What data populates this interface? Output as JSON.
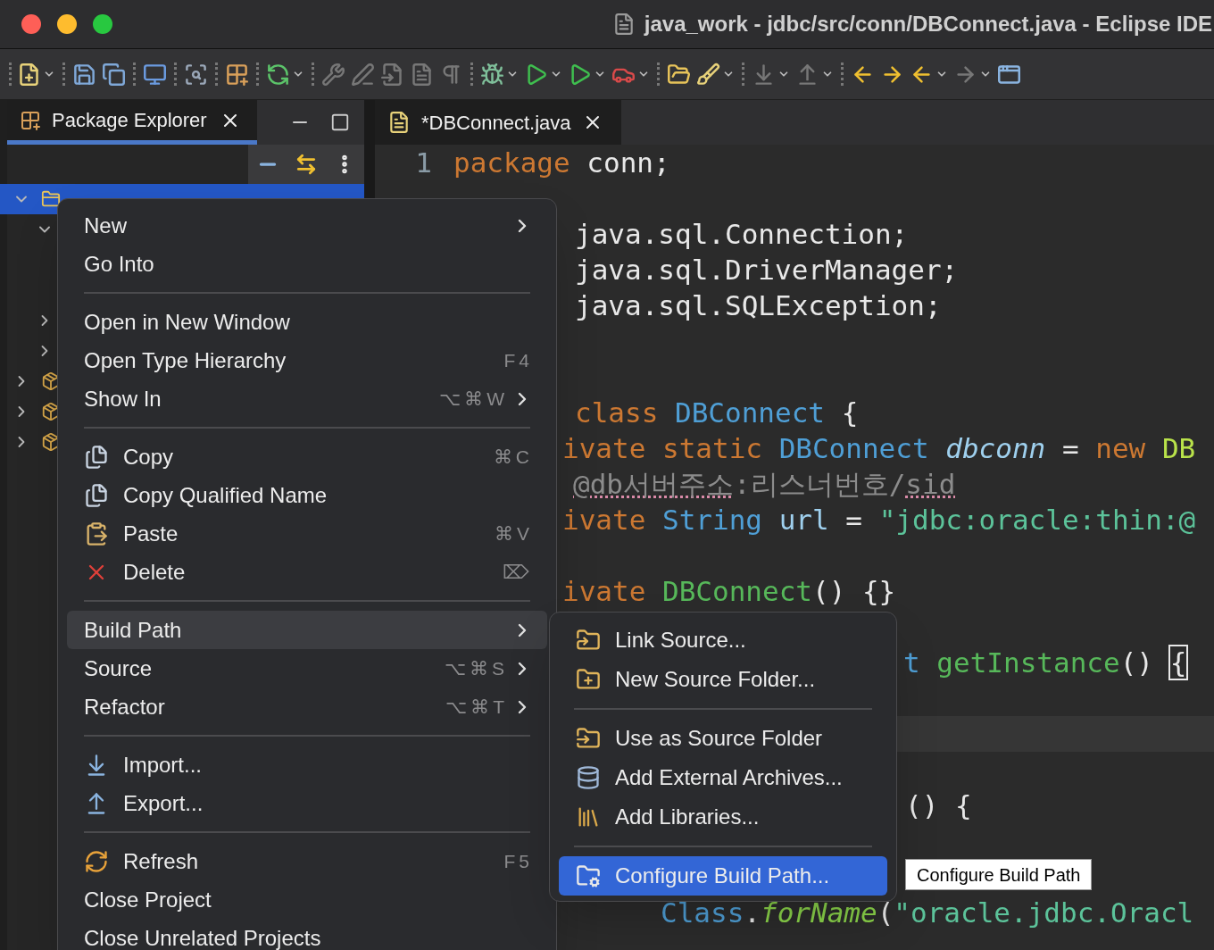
{
  "window": {
    "title": "java_work - jdbc/src/conn/DBConnect.java - Eclipse IDE"
  },
  "package_explorer": {
    "tab": {
      "label": "Package Explorer",
      "selected": true
    },
    "tree": [
      {
        "kind": "node",
        "expanded": true,
        "selected": true,
        "children": [
          {
            "kind": "node",
            "expanded": true,
            "selected": false,
            "children": [
              {
                "kind": "covered"
              },
              {
                "kind": "covered"
              }
            ]
          },
          {
            "kind": "node",
            "expanded": false,
            "selected": false
          },
          {
            "kind": "node",
            "expanded": false,
            "selected": false
          }
        ]
      },
      {
        "kind": "node",
        "expanded": false,
        "selected": false
      },
      {
        "kind": "node",
        "expanded": false,
        "selected": false
      },
      {
        "kind": "node",
        "expanded": false,
        "selected": false
      }
    ]
  },
  "editor": {
    "tab": {
      "label": "*DBConnect.java",
      "selected": true
    },
    "lines": [
      {
        "kind": "code",
        "number": "1",
        "tokens": [
          {
            "kind": "keyword",
            "text": "package"
          },
          {
            "kind": "plain",
            "text": " conn;"
          }
        ]
      },
      {
        "kind": "code",
        "tokens": [
          {
            "kind": "plain",
            "text": "java.sql.Connection;"
          }
        ]
      },
      {
        "kind": "code",
        "tokens": [
          {
            "kind": "plain",
            "text": "java.sql.DriverManager;"
          }
        ]
      },
      {
        "kind": "code",
        "tokens": [
          {
            "kind": "plain",
            "text": "java.sql.SQLException;"
          }
        ]
      },
      {
        "kind": "code",
        "tokens": [
          {
            "kind": "keyword",
            "text": "class"
          },
          {
            "kind": "type",
            "text": " DBConnect"
          },
          {
            "kind": "plain",
            "text": " {"
          }
        ]
      },
      {
        "kind": "code",
        "tokens": [
          {
            "kind": "keyword",
            "text": "ivate static"
          },
          {
            "kind": "type",
            "text": " DBConnect"
          },
          {
            "kind": "static_field",
            "text": " dbconn"
          },
          {
            "kind": "plain",
            "text": " = "
          },
          {
            "kind": "keyword",
            "text": "new"
          },
          {
            "kind": "class_ref",
            "text": " DB"
          }
        ]
      },
      {
        "kind": "code",
        "tokens": [
          {
            "kind": "comment",
            "text": "@db서버주소",
            "underlined": true
          },
          {
            "kind": "comment",
            "text": ":리스너번호/"
          },
          {
            "kind": "comment",
            "text": "sid",
            "underlined": true
          }
        ]
      },
      {
        "kind": "code",
        "tokens": [
          {
            "kind": "keyword",
            "text": "ivate"
          },
          {
            "kind": "type",
            "text": " String"
          },
          {
            "kind": "field",
            "text": " url"
          },
          {
            "kind": "plain",
            "text": " = "
          },
          {
            "kind": "string",
            "text": "\"jdbc:oracle:thin:@"
          }
        ]
      },
      {
        "kind": "code",
        "tokens": [
          {
            "kind": "keyword",
            "text": "ivate"
          },
          {
            "kind": "method",
            "text": " DBConnect"
          },
          {
            "kind": "plain",
            "text": "() {}"
          }
        ]
      },
      {
        "kind": "code",
        "tokens": [
          {
            "kind": "type",
            "text": "t"
          },
          {
            "kind": "method",
            "text": " getInstance"
          },
          {
            "kind": "plain",
            "text": "() "
          },
          {
            "kind": "plain",
            "text": "{",
            "boxed": true
          }
        ]
      },
      {
        "kind": "current_line"
      },
      {
        "kind": "code",
        "tokens": [
          {
            "kind": "plain",
            "text": "() {"
          }
        ]
      },
      {
        "kind": "code",
        "tokens": [
          {
            "kind": "type",
            "text": "Class"
          },
          {
            "kind": "plain",
            "text": "."
          },
          {
            "kind": "static_method",
            "text": "forName"
          },
          {
            "kind": "plain",
            "text": "("
          },
          {
            "kind": "string",
            "text": "\"oracle.jdbc.Oracl"
          }
        ]
      }
    ]
  },
  "context_menu": {
    "items": [
      {
        "kind": "item",
        "label": "New",
        "submenu": true,
        "selected": false
      },
      {
        "kind": "item",
        "label": "Go Into",
        "selected": false
      },
      {
        "kind": "separator"
      },
      {
        "kind": "item",
        "label": "Open in New Window",
        "selected": false
      },
      {
        "kind": "item",
        "label": "Open Type Hierarchy",
        "shortcut": "F4",
        "selected": false
      },
      {
        "kind": "item",
        "label": "Show In",
        "shortcut": "⌥⌘W",
        "submenu": true,
        "selected": false
      },
      {
        "kind": "separator"
      },
      {
        "kind": "item",
        "label": "Copy",
        "shortcut": "⌘C",
        "selected": false
      },
      {
        "kind": "item",
        "label": "Copy Qualified Name",
        "selected": false
      },
      {
        "kind": "item",
        "label": "Paste",
        "shortcut": "⌘V",
        "selected": false
      },
      {
        "kind": "item",
        "label": "Delete",
        "shortcut": "⌦",
        "selected": false
      },
      {
        "kind": "separator"
      },
      {
        "kind": "item",
        "label": "Build Path",
        "submenu": true,
        "selected": true
      },
      {
        "kind": "item",
        "label": "Source",
        "shortcut": "⌥⌘S",
        "submenu": true,
        "selected": false
      },
      {
        "kind": "item",
        "label": "Refactor",
        "shortcut": "⌥⌘T",
        "submenu": true,
        "selected": false
      },
      {
        "kind": "separator"
      },
      {
        "kind": "item",
        "label": "Import...",
        "selected": false
      },
      {
        "kind": "item",
        "label": "Export...",
        "selected": false
      },
      {
        "kind": "separator"
      },
      {
        "kind": "item",
        "label": "Refresh",
        "shortcut": "F5",
        "selected": false
      },
      {
        "kind": "item",
        "label": "Close Project",
        "selected": false
      },
      {
        "kind": "item",
        "label": "Close Unrelated Projects",
        "selected": false
      }
    ]
  },
  "submenu": {
    "items": [
      {
        "kind": "item",
        "label": "Link Source...",
        "selected": false
      },
      {
        "kind": "item",
        "label": "New Source Folder...",
        "selected": false
      },
      {
        "kind": "separator"
      },
      {
        "kind": "item",
        "label": "Use as Source Folder",
        "selected": false
      },
      {
        "kind": "item",
        "label": "Add External Archives...",
        "selected": false
      },
      {
        "kind": "item",
        "label": "Add Libraries...",
        "selected": false
      },
      {
        "kind": "separator"
      },
      {
        "kind": "item",
        "label": "Configure Build Path...",
        "selected": true
      }
    ]
  },
  "tooltip": {
    "text": "Configure Build Path"
  }
}
